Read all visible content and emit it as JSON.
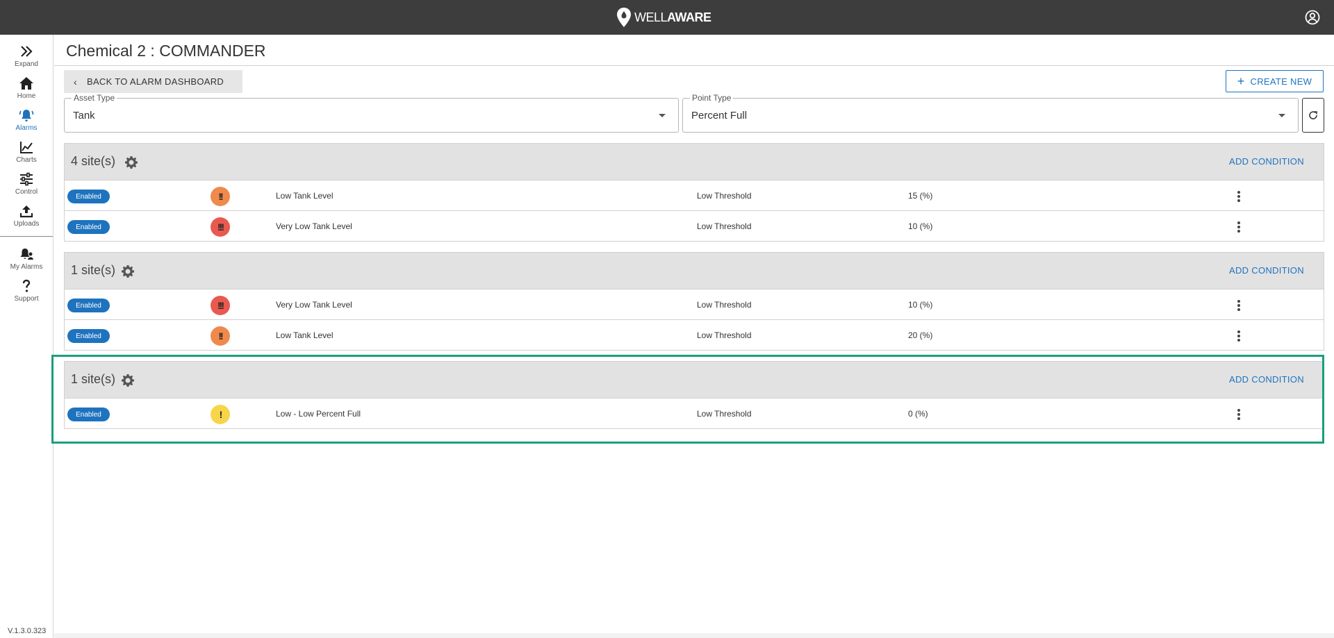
{
  "app": {
    "brand_light": "WELL",
    "brand_bold": "AWARE"
  },
  "sidebar": {
    "items": [
      {
        "label": "Expand",
        "icon": "double-chevron-right-icon"
      },
      {
        "label": "Home",
        "icon": "home-icon"
      },
      {
        "label": "Alarms",
        "icon": "alarm-bell-icon",
        "active": true
      },
      {
        "label": "Charts",
        "icon": "line-chart-icon"
      },
      {
        "label": "Control",
        "icon": "sliders-icon"
      },
      {
        "label": "Uploads",
        "icon": "upload-icon"
      },
      {
        "label": "My Alarms",
        "icon": "user-bell-icon"
      },
      {
        "label": "Support",
        "icon": "question-icon"
      }
    ],
    "version": "V.1.3.0.323"
  },
  "page": {
    "title": "Chemical 2 : COMMANDER"
  },
  "toolbar": {
    "back_label": "BACK TO ALARM DASHBOARD",
    "create_label": "CREATE NEW"
  },
  "filters": {
    "asset_type": {
      "label": "Asset Type",
      "value": "Tank"
    },
    "point_type": {
      "label": "Point Type",
      "value": "Percent Full"
    }
  },
  "groups": [
    {
      "title": "4 site(s)",
      "action": "ADD CONDITION",
      "rows": [
        {
          "status": "Enabled",
          "severity": "!!",
          "name": "Low Tank Level",
          "threshold": "Low Threshold",
          "value": "15 (%)"
        },
        {
          "status": "Enabled",
          "severity": "!!!",
          "name": "Very Low Tank Level",
          "threshold": "Low Threshold",
          "value": "10 (%)"
        }
      ]
    },
    {
      "title": "1 site(s)",
      "action": "ADD CONDITION",
      "rows": [
        {
          "status": "Enabled",
          "severity": "!!!",
          "name": "Very Low Tank Level",
          "threshold": "Low Threshold",
          "value": "10 (%)"
        },
        {
          "status": "Enabled",
          "severity": "!!",
          "name": "Low Tank Level",
          "threshold": "Low Threshold",
          "value": "20 (%)"
        }
      ]
    },
    {
      "title": "1 site(s)",
      "action": "ADD CONDITION",
      "rows": [
        {
          "status": "Enabled",
          "severity": "!",
          "name": "Low - Low Percent Full",
          "threshold": "Low Threshold",
          "value": "0 (%)"
        }
      ]
    }
  ],
  "colors": {
    "topbar": "#3d3d3d",
    "accent": "#1e73be",
    "severity_high": "#ef8a4c",
    "severity_critical": "#e85a4f",
    "severity_low": "#f7d54a",
    "highlight": "#1a9e7e"
  }
}
